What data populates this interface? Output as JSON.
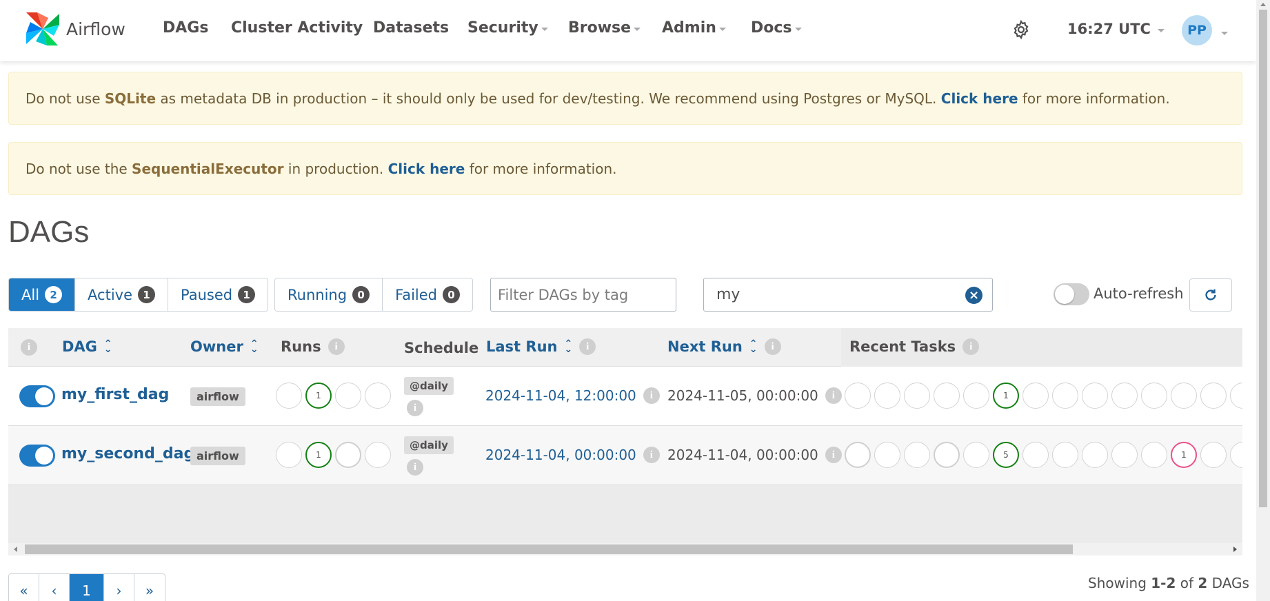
{
  "navbar": {
    "brand": "Airflow",
    "items": [
      {
        "label": "DAGs",
        "dropdown": false
      },
      {
        "label": "Cluster Activity",
        "dropdown": false
      },
      {
        "label": "Datasets",
        "dropdown": false
      },
      {
        "label": "Security",
        "dropdown": true
      },
      {
        "label": "Browse",
        "dropdown": true
      },
      {
        "label": "Admin",
        "dropdown": true
      },
      {
        "label": "Docs",
        "dropdown": true
      }
    ],
    "time": "16:27 UTC",
    "user_initials": "PP"
  },
  "alerts": {
    "sqlite": {
      "pre": "Do not use ",
      "bold": "SQLite",
      "mid": " as metadata DB in production – it should only be used for dev/testing. We recommend using Postgres or MySQL. ",
      "link": "Click here",
      "post": " for more information."
    },
    "executor": {
      "pre": "Do not use the ",
      "bold": "SequentialExecutor",
      "mid": " in production. ",
      "link": "Click here",
      "post": " for more information."
    }
  },
  "page_title": "DAGs",
  "status_filters": {
    "all": {
      "label": "All",
      "count": "2"
    },
    "active": {
      "label": "Active",
      "count": "1"
    },
    "paused": {
      "label": "Paused",
      "count": "1"
    },
    "running": {
      "label": "Running",
      "count": "0"
    },
    "failed": {
      "label": "Failed",
      "count": "0"
    }
  },
  "tag_filter": {
    "placeholder": "Filter DAGs by tag"
  },
  "search": {
    "value": "my"
  },
  "auto_refresh": {
    "label": "Auto-refresh",
    "enabled": false
  },
  "table": {
    "headers": {
      "dag": "DAG",
      "owner": "Owner",
      "runs": "Runs",
      "schedule": "Schedule",
      "last_run": "Last Run",
      "next_run": "Next Run",
      "recent_tasks": "Recent Tasks"
    },
    "rows": [
      {
        "name": "my_first_dag",
        "owner": "airflow",
        "runs_count": "1",
        "schedule": "@daily",
        "last_run": "2024-11-04, 12:00:00",
        "next_run": "2024-11-05, 00:00:00",
        "task_counts": [
          "1"
        ]
      },
      {
        "name": "my_second_dag",
        "owner": "airflow",
        "runs_count": "1",
        "schedule": "@daily",
        "last_run": "2024-11-04, 00:00:00",
        "next_run": "2024-11-04, 00:00:00",
        "task_counts": [
          "5",
          "1"
        ]
      }
    ]
  },
  "pagination": {
    "first": "«",
    "prev": "‹",
    "current": "1",
    "next": "›",
    "last": "»"
  },
  "showing": {
    "pre": "Showing ",
    "range": "1-2",
    "mid": " of ",
    "total": "2",
    "post": " DAGs"
  },
  "colors": {
    "accent": "#1f7ac4",
    "link": "#1f5f95",
    "success": "#138013",
    "upstream_failed": "#e9508a",
    "alert_bg": "#fcf8e3"
  }
}
